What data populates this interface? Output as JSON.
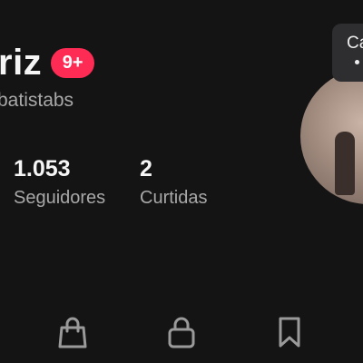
{
  "profile": {
    "display_name": "riz",
    "notification_badge": "9+",
    "username": "batistabs"
  },
  "stats": {
    "followers": {
      "value": "1.053",
      "label": "Seguidores"
    },
    "likes": {
      "value": "2",
      "label": "Curtidas"
    }
  },
  "tooltip": {
    "text": "Ca"
  },
  "tabs": [
    {
      "icon": "shopping-bag-icon"
    },
    {
      "icon": "lock-icon"
    },
    {
      "icon": "bookmark-icon"
    }
  ],
  "colors": {
    "background": "#141414",
    "badge": "#fe2c55",
    "primary_text": "#f5f5f5",
    "secondary_text": "#a8a8a8"
  }
}
